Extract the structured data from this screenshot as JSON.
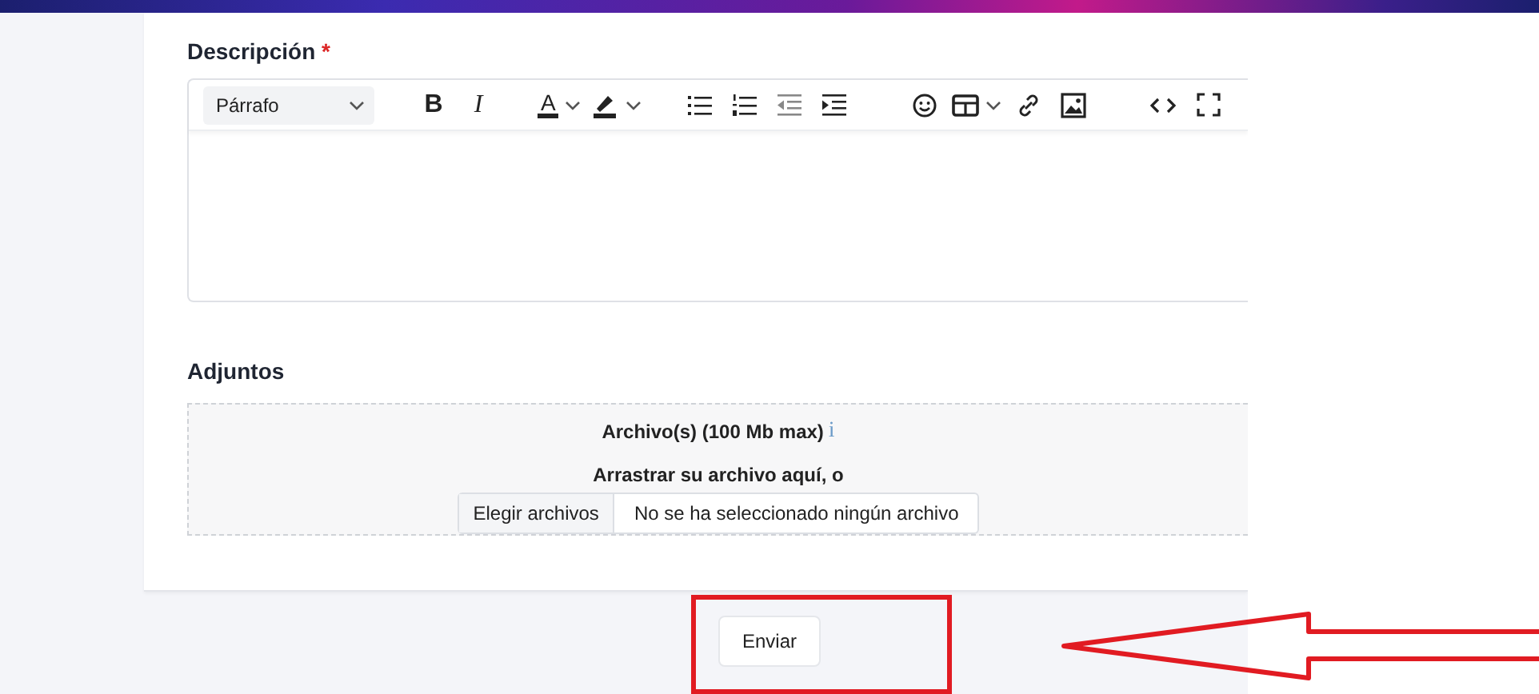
{
  "description": {
    "label": "Descripción",
    "required_mark": "*"
  },
  "editor": {
    "format_select": "Párrafo",
    "toolbar_groups": [
      [
        {
          "kind": "bold",
          "label": "B"
        },
        {
          "kind": "italic",
          "label": "I"
        }
      ],
      [
        {
          "kind": "text-color",
          "label": "A"
        },
        {
          "kind": "highlight"
        }
      ],
      [
        {
          "kind": "bullet-list"
        },
        {
          "kind": "numbered-list"
        },
        {
          "kind": "outdent"
        },
        {
          "kind": "indent"
        }
      ],
      [
        {
          "kind": "emoji"
        },
        {
          "kind": "table"
        },
        {
          "kind": "link"
        },
        {
          "kind": "image"
        }
      ],
      [
        {
          "kind": "code"
        },
        {
          "kind": "fullscreen"
        }
      ]
    ]
  },
  "attachments": {
    "label": "Adjuntos",
    "limit": "Archivo(s) (100 Mb max)",
    "info": "i",
    "drop_hint": "Arrastrar su archivo aquí, o",
    "choose_button": "Elegir archivos",
    "file_status": "No se ha seleccionado ningún archivo"
  },
  "submit_button": "Enviar",
  "annotations": {
    "highlight_box": true,
    "pointer_arrow": true
  }
}
